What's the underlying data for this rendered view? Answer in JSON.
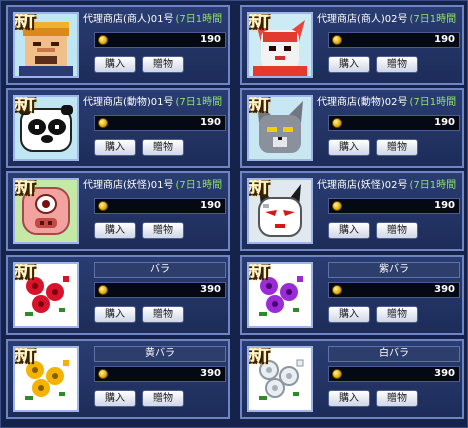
{
  "new_badge": "新",
  "buy_label": "購入",
  "gift_label": "贈物",
  "items": [
    {
      "name": "代理商店(商人)01号",
      "duration": "(7日1時間",
      "price": "190",
      "icon": "merchant-icon",
      "art": "merchant"
    },
    {
      "name": "代理商店(商人)02号",
      "duration": "(7日1時間",
      "price": "190",
      "icon": "fox-merchant-icon",
      "art": "redfox"
    },
    {
      "name": "代理商店(動物)01号",
      "duration": "(7日1時間",
      "price": "190",
      "icon": "panda-icon",
      "art": "panda"
    },
    {
      "name": "代理商店(動物)02号",
      "duration": "(7日1時間",
      "price": "190",
      "icon": "gray-wolf-icon",
      "art": "wolf"
    },
    {
      "name": "代理商店(妖怪)01号",
      "duration": "(7日1時間",
      "price": "190",
      "icon": "pig-monster-icon",
      "art": "pig"
    },
    {
      "name": "代理商店(妖怪)02号",
      "duration": "(7日1時間",
      "price": "190",
      "icon": "white-demon-icon",
      "art": "demon"
    },
    {
      "name": "バラ",
      "price": "390",
      "icon": "red-rose-icon",
      "art": "rose",
      "rose_color": "#d8122a"
    },
    {
      "name": "紫バラ",
      "price": "390",
      "icon": "purple-rose-icon",
      "art": "rose",
      "rose_color": "#9b2bd6"
    },
    {
      "name": "黄バラ",
      "price": "390",
      "icon": "yellow-rose-icon",
      "art": "rose",
      "rose_color": "#f2b400"
    },
    {
      "name": "白バラ",
      "price": "390",
      "icon": "white-rose-icon",
      "art": "rose",
      "rose_color": "#e9eef2"
    }
  ]
}
